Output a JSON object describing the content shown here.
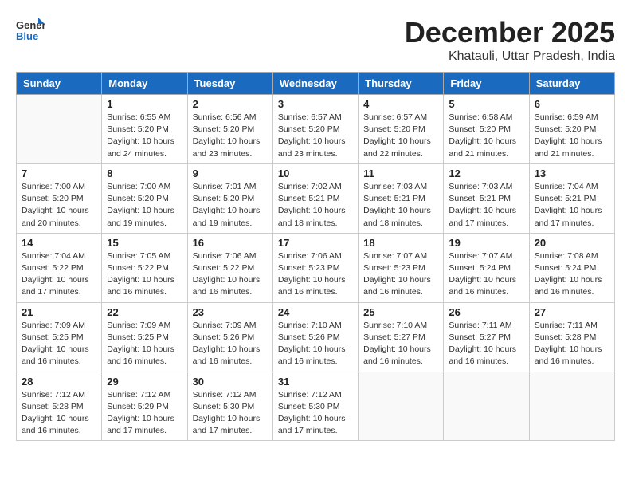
{
  "logo": {
    "general": "General",
    "blue": "Blue"
  },
  "header": {
    "month": "December 2025",
    "location": "Khatauli, Uttar Pradesh, India"
  },
  "weekdays": [
    "Sunday",
    "Monday",
    "Tuesday",
    "Wednesday",
    "Thursday",
    "Friday",
    "Saturday"
  ],
  "weeks": [
    [
      {
        "day": "",
        "info": ""
      },
      {
        "day": "1",
        "info": "Sunrise: 6:55 AM\nSunset: 5:20 PM\nDaylight: 10 hours\nand 24 minutes."
      },
      {
        "day": "2",
        "info": "Sunrise: 6:56 AM\nSunset: 5:20 PM\nDaylight: 10 hours\nand 23 minutes."
      },
      {
        "day": "3",
        "info": "Sunrise: 6:57 AM\nSunset: 5:20 PM\nDaylight: 10 hours\nand 23 minutes."
      },
      {
        "day": "4",
        "info": "Sunrise: 6:57 AM\nSunset: 5:20 PM\nDaylight: 10 hours\nand 22 minutes."
      },
      {
        "day": "5",
        "info": "Sunrise: 6:58 AM\nSunset: 5:20 PM\nDaylight: 10 hours\nand 21 minutes."
      },
      {
        "day": "6",
        "info": "Sunrise: 6:59 AM\nSunset: 5:20 PM\nDaylight: 10 hours\nand 21 minutes."
      }
    ],
    [
      {
        "day": "7",
        "info": "Sunrise: 7:00 AM\nSunset: 5:20 PM\nDaylight: 10 hours\nand 20 minutes."
      },
      {
        "day": "8",
        "info": "Sunrise: 7:00 AM\nSunset: 5:20 PM\nDaylight: 10 hours\nand 19 minutes."
      },
      {
        "day": "9",
        "info": "Sunrise: 7:01 AM\nSunset: 5:20 PM\nDaylight: 10 hours\nand 19 minutes."
      },
      {
        "day": "10",
        "info": "Sunrise: 7:02 AM\nSunset: 5:21 PM\nDaylight: 10 hours\nand 18 minutes."
      },
      {
        "day": "11",
        "info": "Sunrise: 7:03 AM\nSunset: 5:21 PM\nDaylight: 10 hours\nand 18 minutes."
      },
      {
        "day": "12",
        "info": "Sunrise: 7:03 AM\nSunset: 5:21 PM\nDaylight: 10 hours\nand 17 minutes."
      },
      {
        "day": "13",
        "info": "Sunrise: 7:04 AM\nSunset: 5:21 PM\nDaylight: 10 hours\nand 17 minutes."
      }
    ],
    [
      {
        "day": "14",
        "info": "Sunrise: 7:04 AM\nSunset: 5:22 PM\nDaylight: 10 hours\nand 17 minutes."
      },
      {
        "day": "15",
        "info": "Sunrise: 7:05 AM\nSunset: 5:22 PM\nDaylight: 10 hours\nand 16 minutes."
      },
      {
        "day": "16",
        "info": "Sunrise: 7:06 AM\nSunset: 5:22 PM\nDaylight: 10 hours\nand 16 minutes."
      },
      {
        "day": "17",
        "info": "Sunrise: 7:06 AM\nSunset: 5:23 PM\nDaylight: 10 hours\nand 16 minutes."
      },
      {
        "day": "18",
        "info": "Sunrise: 7:07 AM\nSunset: 5:23 PM\nDaylight: 10 hours\nand 16 minutes."
      },
      {
        "day": "19",
        "info": "Sunrise: 7:07 AM\nSunset: 5:24 PM\nDaylight: 10 hours\nand 16 minutes."
      },
      {
        "day": "20",
        "info": "Sunrise: 7:08 AM\nSunset: 5:24 PM\nDaylight: 10 hours\nand 16 minutes."
      }
    ],
    [
      {
        "day": "21",
        "info": "Sunrise: 7:09 AM\nSunset: 5:25 PM\nDaylight: 10 hours\nand 16 minutes."
      },
      {
        "day": "22",
        "info": "Sunrise: 7:09 AM\nSunset: 5:25 PM\nDaylight: 10 hours\nand 16 minutes."
      },
      {
        "day": "23",
        "info": "Sunrise: 7:09 AM\nSunset: 5:26 PM\nDaylight: 10 hours\nand 16 minutes."
      },
      {
        "day": "24",
        "info": "Sunrise: 7:10 AM\nSunset: 5:26 PM\nDaylight: 10 hours\nand 16 minutes."
      },
      {
        "day": "25",
        "info": "Sunrise: 7:10 AM\nSunset: 5:27 PM\nDaylight: 10 hours\nand 16 minutes."
      },
      {
        "day": "26",
        "info": "Sunrise: 7:11 AM\nSunset: 5:27 PM\nDaylight: 10 hours\nand 16 minutes."
      },
      {
        "day": "27",
        "info": "Sunrise: 7:11 AM\nSunset: 5:28 PM\nDaylight: 10 hours\nand 16 minutes."
      }
    ],
    [
      {
        "day": "28",
        "info": "Sunrise: 7:12 AM\nSunset: 5:28 PM\nDaylight: 10 hours\nand 16 minutes."
      },
      {
        "day": "29",
        "info": "Sunrise: 7:12 AM\nSunset: 5:29 PM\nDaylight: 10 hours\nand 17 minutes."
      },
      {
        "day": "30",
        "info": "Sunrise: 7:12 AM\nSunset: 5:30 PM\nDaylight: 10 hours\nand 17 minutes."
      },
      {
        "day": "31",
        "info": "Sunrise: 7:12 AM\nSunset: 5:30 PM\nDaylight: 10 hours\nand 17 minutes."
      },
      {
        "day": "",
        "info": ""
      },
      {
        "day": "",
        "info": ""
      },
      {
        "day": "",
        "info": ""
      }
    ]
  ]
}
